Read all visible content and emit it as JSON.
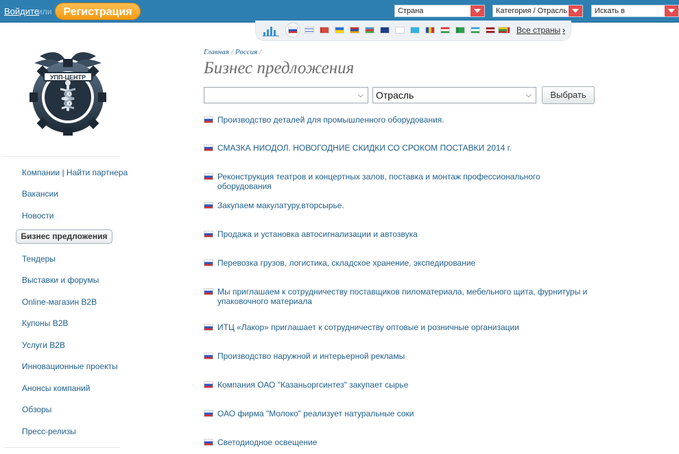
{
  "topbar": {
    "login": "Войдите",
    "or": "или",
    "register": "Регистрация",
    "country_select": "Страна",
    "category_select": "Категория / Отрасль",
    "search_select": "Искать в"
  },
  "flagbar": {
    "all_countries": "Все страны",
    "chevron": "›"
  },
  "breadcrumb": {
    "home": "Главная",
    "country": "Россия",
    "separator": "/"
  },
  "page": {
    "title": "Бизнес предложения"
  },
  "filters": {
    "first_select": "",
    "industry_select": "Отрасль",
    "submit": "Выбрать"
  },
  "sidebar": {
    "items": [
      {
        "label": "Компании | Найти партнера"
      },
      {
        "label": "Вакансии"
      },
      {
        "label": "Новости"
      },
      {
        "label": "Бизнес предложения"
      },
      {
        "label": "Тендеры"
      },
      {
        "label": "Выставки и форумы"
      },
      {
        "label": "Online-магазин B2B"
      },
      {
        "label": "Купоны B2B"
      },
      {
        "label": "Услуги B2B"
      },
      {
        "label": "Инновационные проекты"
      },
      {
        "label": "Анонсы компаний"
      },
      {
        "label": "Обзоры"
      },
      {
        "label": "Пресс-релизы"
      }
    ]
  },
  "offers": [
    {
      "text": "Производство деталей для промышленного оборудования."
    },
    {
      "text": "СМАЗКА НИОДОЛ. НОВОГОДНИЕ СКИДКИ СО СРОКОМ ПОСТАВКИ 2014 г."
    },
    {
      "text": "Реконструкция театров и концертных залов, поставка и монтаж профессионального оборудования"
    },
    {
      "text": "Закупаем макулатуру,вторсырье."
    },
    {
      "text": "Продажа и установка автосигнализации и автозвука"
    },
    {
      "text": "Перевозка грузов, логистика, складское хранение, экспедирование"
    },
    {
      "text": "Мы приглашаем к сотрудничеству поставщиков пиломатериала, мебельного щита, фурнитуры и упаковочного материала"
    },
    {
      "text": "ИТЦ «Лакор» приглашает к сотрудничеству оптовые и розничные организации"
    },
    {
      "text": "Производство наружной и интерьерной рекламы"
    },
    {
      "text": "Компания ОАО \"Казаньоргсинтез\" закупает сырье"
    },
    {
      "text": "ОАО фирма \"Молоко\" реализует натуральные соки"
    },
    {
      "text": "Светодиодное освещение"
    }
  ],
  "colors": {
    "topbar": "#2e7fb1",
    "accent_orange": "#f39a12",
    "dropdown_arrow": "#e74c4c",
    "link": "#1f5f8b"
  }
}
